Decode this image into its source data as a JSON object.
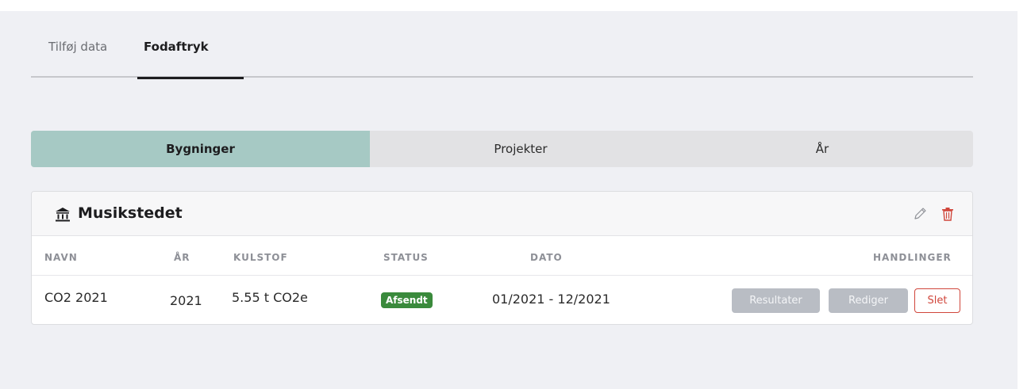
{
  "tabs": [
    {
      "label": "Tilføj data",
      "active": false
    },
    {
      "label": "Fodaftryk",
      "active": true
    }
  ],
  "segments": [
    {
      "label": "Bygninger",
      "active": true
    },
    {
      "label": "Projekter",
      "active": false
    },
    {
      "label": "År",
      "active": false
    }
  ],
  "card": {
    "title": "Musikstedet",
    "icon": "bank-icon",
    "actions": [
      "pencil-icon",
      "trash-icon"
    ],
    "columns": [
      "NAVN",
      "ÅR",
      "KULSTOF",
      "STATUS",
      "DATO",
      "HANDLINGER"
    ],
    "rows": [
      {
        "navn": "CO2 2021",
        "aar": "2021",
        "kulstof": "5.55 t CO2e",
        "status": "Afsendt",
        "dato": "01/2021 - 12/2021",
        "buttons": {
          "results": "Resultater",
          "edit": "Rediger",
          "delete": "Slet"
        }
      }
    ]
  },
  "colors": {
    "accent_segment": "#a6c9c4",
    "status_green": "#3a8a3c",
    "delete_red": "#d0463b",
    "background": "#eff0f4"
  }
}
